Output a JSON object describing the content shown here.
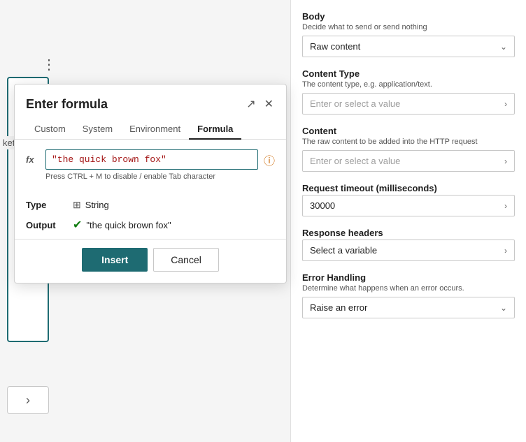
{
  "modal": {
    "title": "Enter formula",
    "tabs": [
      {
        "label": "Custom",
        "active": false
      },
      {
        "label": "System",
        "active": false
      },
      {
        "label": "Environment",
        "active": false
      },
      {
        "label": "Formula",
        "active": true
      }
    ],
    "formula_input": "\"the quick brown fox\"",
    "hint": "Press CTRL + M to disable / enable Tab character",
    "type_label": "Type",
    "type_value": "String",
    "output_label": "Output",
    "output_value": "\"the quick brown fox\"",
    "insert_btn": "Insert",
    "cancel_btn": "Cancel"
  },
  "right_panel": {
    "body_label": "Body",
    "body_sub": "Decide what to send or send nothing",
    "body_value": "Raw content",
    "content_type_label": "Content Type",
    "content_type_sub": "The content type, e.g. application/text.",
    "content_type_placeholder": "Enter or select a value",
    "content_label": "Content",
    "content_sub": "The raw content to be added into the HTTP request",
    "content_placeholder": "Enter or select a value",
    "timeout_label": "Request timeout (milliseconds)",
    "timeout_value": "30000",
    "response_headers_label": "Response headers",
    "response_headers_value": "Select a variable",
    "error_handling_label": "Error Handling",
    "error_handling_sub": "Determine what happens when an error occurs.",
    "error_handling_value": "Raise an error"
  },
  "icons": {
    "expand": "↗",
    "close": "✕",
    "chevron_down": "⌄",
    "chevron_right": "›",
    "info": "ⓘ",
    "string_type": "⊞",
    "check": "✔",
    "three_dots": "⋮"
  }
}
